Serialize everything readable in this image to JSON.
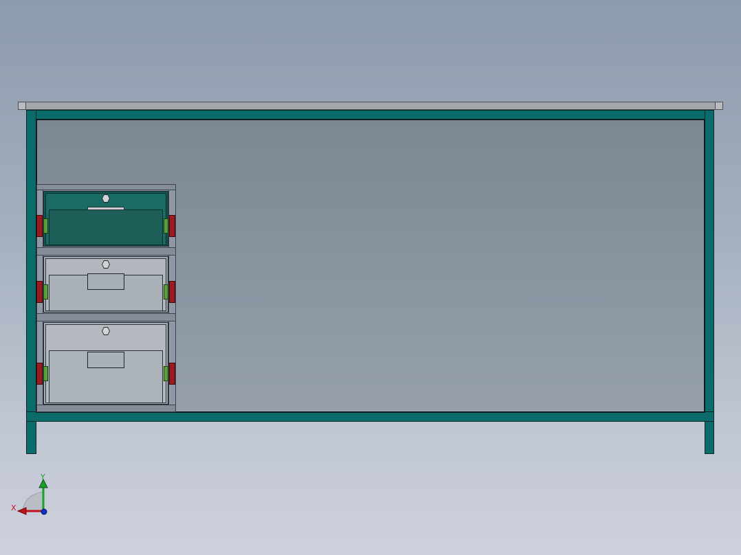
{
  "viewport": {
    "name": "cad-front-view",
    "background_top": "#8c9bad",
    "background_bottom": "#cdd1dc"
  },
  "colors": {
    "frame": "#0b6a6a",
    "drawer_selected": "#1d5f58",
    "drawer_normal": "#a9afb7",
    "runner_red": "#9a1c20",
    "runner_green": "#5aa03a",
    "axis_x": "#c0141a",
    "axis_y": "#1aa02a",
    "axis_z": "#1030c0"
  },
  "drawers": [
    {
      "name": "top-drawer",
      "state": "highlighted"
    },
    {
      "name": "middle-drawer",
      "state": "normal"
    },
    {
      "name": "bottom-drawer",
      "state": "normal"
    }
  ],
  "triad": {
    "x_label": "X",
    "y_label": "Y",
    "icon": "coordinate-triad-icon"
  }
}
